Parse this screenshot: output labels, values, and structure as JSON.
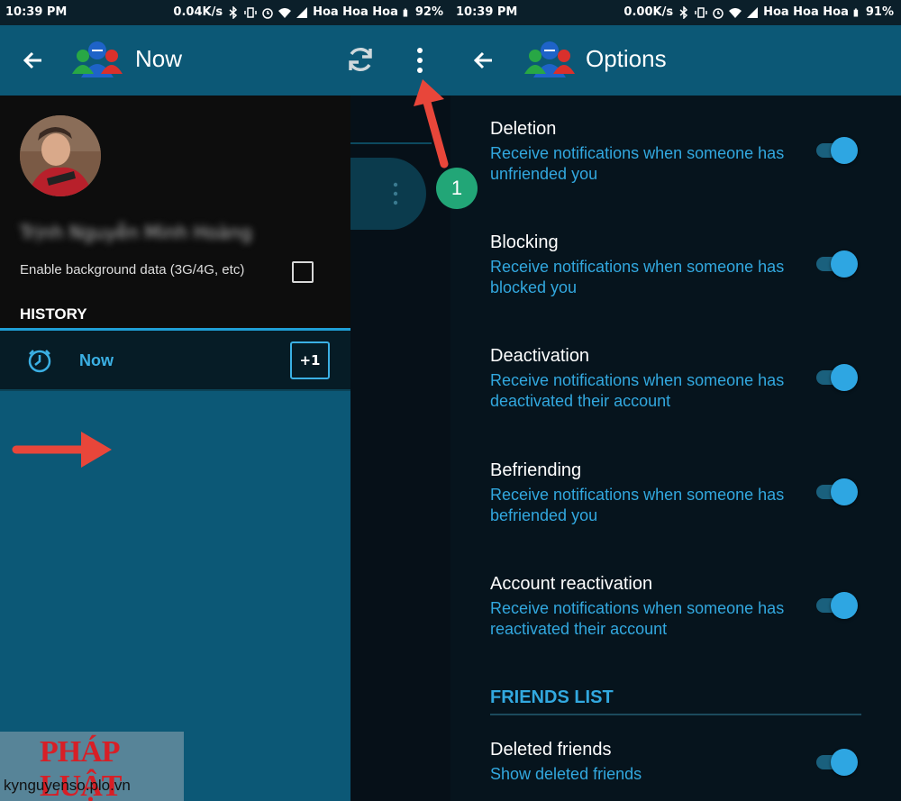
{
  "left": {
    "status": {
      "time": "10:39 PM",
      "speed": "0.04K/s",
      "carrier": "Hoa Hoa Hoa",
      "battery": "92%"
    },
    "appbar": {
      "title": "Now",
      "back_icon": "arrow-left-icon",
      "refresh_icon": "refresh-icon",
      "more_icon": "more-vert-icon"
    },
    "drawer": {
      "user_name": "Trịnh Nguyễn Minh Hoàng",
      "background_data_label": "Enable background data (3G/4G, etc)",
      "background_data_checked": false,
      "history_header": "HISTORY",
      "history_items": [
        {
          "label": "Now",
          "count": "+1"
        }
      ]
    },
    "annotation_step": "1"
  },
  "right": {
    "status": {
      "time": "10:39 PM",
      "speed": "0.00K/s",
      "carrier": "Hoa Hoa Hoa",
      "battery": "91%"
    },
    "appbar": {
      "title": "Options"
    },
    "options": [
      {
        "title": "Deletion",
        "desc": "Receive notifications when someone has unfriended you",
        "enabled": true
      },
      {
        "title": "Blocking",
        "desc": "Receive notifications when someone has blocked you",
        "enabled": true
      },
      {
        "title": "Deactivation",
        "desc": "Receive notifications when someone has deactivated their account",
        "enabled": true
      },
      {
        "title": "Befriending",
        "desc": "Receive notifications when someone has befriended you",
        "enabled": true
      },
      {
        "title": "Account reactivation",
        "desc": "Receive notifications when someone has reactivated their account",
        "enabled": true
      }
    ],
    "friends_list_header": "FRIENDS LIST",
    "friends_options": [
      {
        "title": "Deleted friends",
        "desc": "Show deleted friends",
        "enabled": true
      }
    ]
  },
  "watermark": {
    "logo": "PHÁP LUẬT",
    "site": "kynguyenso.plo.vn"
  },
  "colors": {
    "appbar": "#0c5876",
    "accent": "#32a8df",
    "badge": "#22a677",
    "arrow": "#e8463a"
  }
}
